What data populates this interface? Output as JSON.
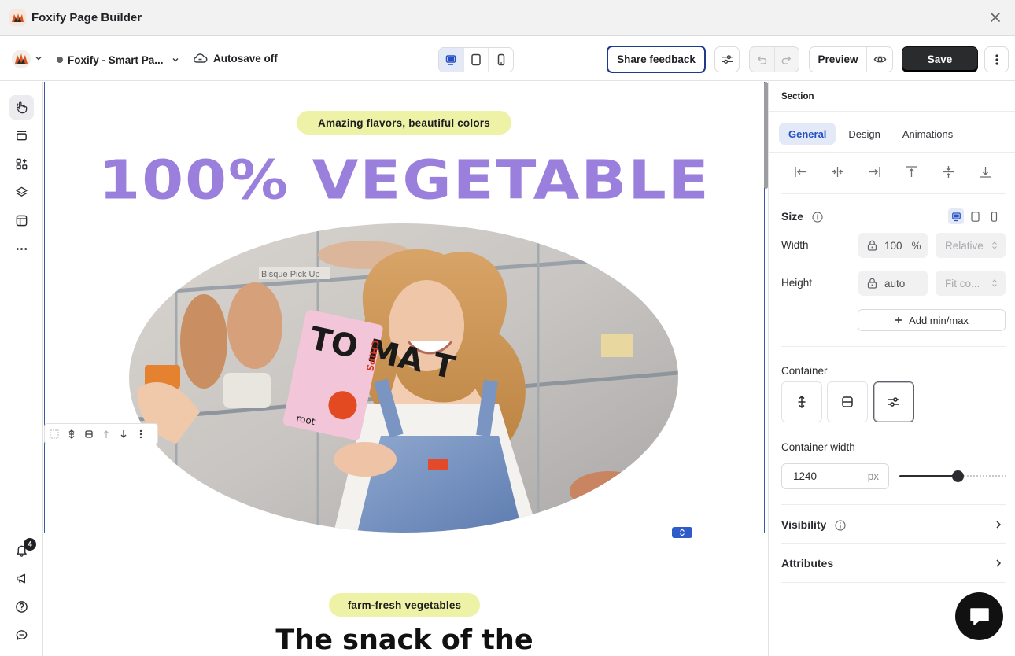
{
  "window": {
    "title": "Foxify Page Builder"
  },
  "toolbar": {
    "page_name": "Foxify - Smart Pa...",
    "autosave": "Autosave off",
    "share_feedback": "Share feedback",
    "preview": "Preview",
    "save": "Save",
    "active_device": "desktop"
  },
  "rail": {
    "items": [
      "pointer-hand-icon",
      "sections-icon",
      "add-elements-icon",
      "layers-icon",
      "theme-icon",
      "more-icon"
    ],
    "bottom": [
      "bell-icon",
      "megaphone-icon",
      "help-icon",
      "chat-icon"
    ],
    "notification_count": "4"
  },
  "canvas": {
    "pill_top": "Amazing flavors, beautiful colors",
    "headline": "100% VEGETABLE",
    "pill_bottom": "farm-fresh vegetables",
    "headline_bottom": "The snack of the",
    "image_texts": {
      "store_sign": "Bisque Pick Up",
      "bag_text": "TO MA T",
      "bag_side": "CHIPS",
      "bag_brand": "root"
    }
  },
  "panel": {
    "header": "Section",
    "tabs": [
      "General",
      "Design",
      "Animations"
    ],
    "active_tab": "General",
    "size_label": "Size",
    "width_label": "Width",
    "width_value": "100",
    "width_unit": "%",
    "width_mode": "Relative",
    "height_label": "Height",
    "height_value": "auto",
    "height_mode": "Fit co...",
    "add_minmax": "Add min/max",
    "container_label": "Container",
    "container_width_label": "Container width",
    "container_width_value": "1240",
    "container_width_unit": "px",
    "container_width_slider": 0.54,
    "visibility_label": "Visibility",
    "attributes_label": "Attributes"
  },
  "colors": {
    "accent": "#2550c4",
    "headline": "#9a7fdc",
    "pill": "#eef2a6",
    "save_bg": "#2a2b2d"
  }
}
